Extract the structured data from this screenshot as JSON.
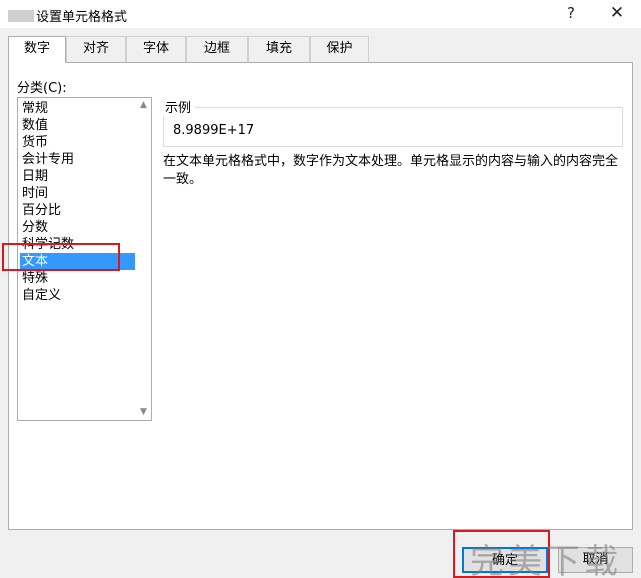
{
  "window": {
    "title": "设置单元格格式",
    "help_label": "?",
    "close_label": "✕"
  },
  "tabs": [
    {
      "label": "数字",
      "active": true
    },
    {
      "label": "对齐",
      "active": false
    },
    {
      "label": "字体",
      "active": false
    },
    {
      "label": "边框",
      "active": false
    },
    {
      "label": "填充",
      "active": false
    },
    {
      "label": "保护",
      "active": false
    }
  ],
  "category": {
    "label": "分类(C):",
    "items": [
      "常规",
      "数值",
      "货币",
      "会计专用",
      "日期",
      "时间",
      "百分比",
      "分数",
      "科学记数",
      "文本",
      "特殊",
      "自定义"
    ],
    "selected": "文本"
  },
  "sample": {
    "legend": "示例",
    "value": "8.9899E+17"
  },
  "description": "在文本单元格格式中，数字作为文本处理。单元格显示的内容与输入的内容完全一致。",
  "buttons": {
    "ok_label": "确定",
    "cancel_label": "取消"
  },
  "watermark": "完美下载",
  "colors": {
    "selection": "#3399ff",
    "highlight_box": "#d71920",
    "ok_border": "#0078d7"
  }
}
